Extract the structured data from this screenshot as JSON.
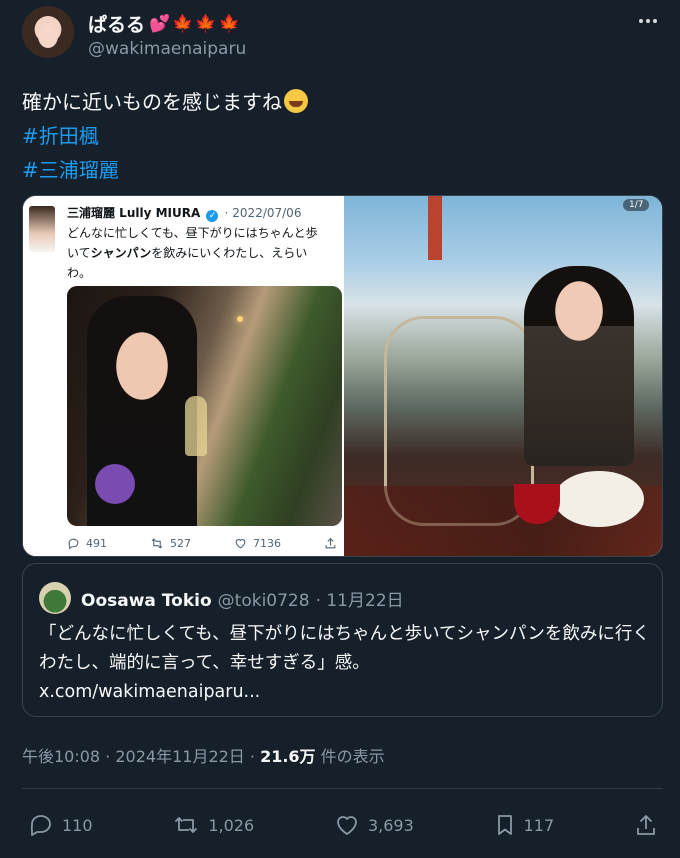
{
  "author": {
    "display_name": "ぱるる",
    "decor_heart": "💕",
    "decor_leaves": [
      "🍁",
      "🍁",
      "🍁"
    ],
    "handle": "@wakimaenaiparu"
  },
  "tweet": {
    "text": "確かに近いものを感じますね",
    "emoji": "joy-emoji",
    "hashtags": [
      "#折田楓",
      "#三浦瑠麗"
    ]
  },
  "media": {
    "counter": "1/7",
    "embedded_tweet": {
      "name": "三浦瑠麗 Lully MIURA",
      "verified_mark": "✓",
      "date": "· 2022/07/06",
      "text_before": "どんなに忙しくても、昼下がりにはちゃんと歩",
      "text_line2_pre": "いて",
      "text_bold": "シャンパン",
      "text_line2_post": "を飲みにいくわたし、えらい",
      "text_line3": "わ。",
      "replies": "491",
      "retweets": "527",
      "likes": "7136"
    }
  },
  "quote": {
    "name": "Oosawa Tokio",
    "handle": "@toki0728",
    "date": "· 11月22日",
    "text": "「どんなに忙しくても、昼下がりにはちゃんと歩いてシャンパンを飲みに行くわたし、端的に言って、幸せすぎる」感。",
    "link": "x.com/wakimaenaiparu..."
  },
  "timestamp": {
    "time": "午後10:08 · 2024年11月22日 · ",
    "views_count": "21.6万",
    "views_label": " 件の表示"
  },
  "actions": {
    "replies": "110",
    "retweets": "1,026",
    "likes": "3,693",
    "bookmarks": "117"
  },
  "colors": {
    "background": "#15202b",
    "accent": "#1d9bf0",
    "secondary_text": "#8b98a5"
  }
}
